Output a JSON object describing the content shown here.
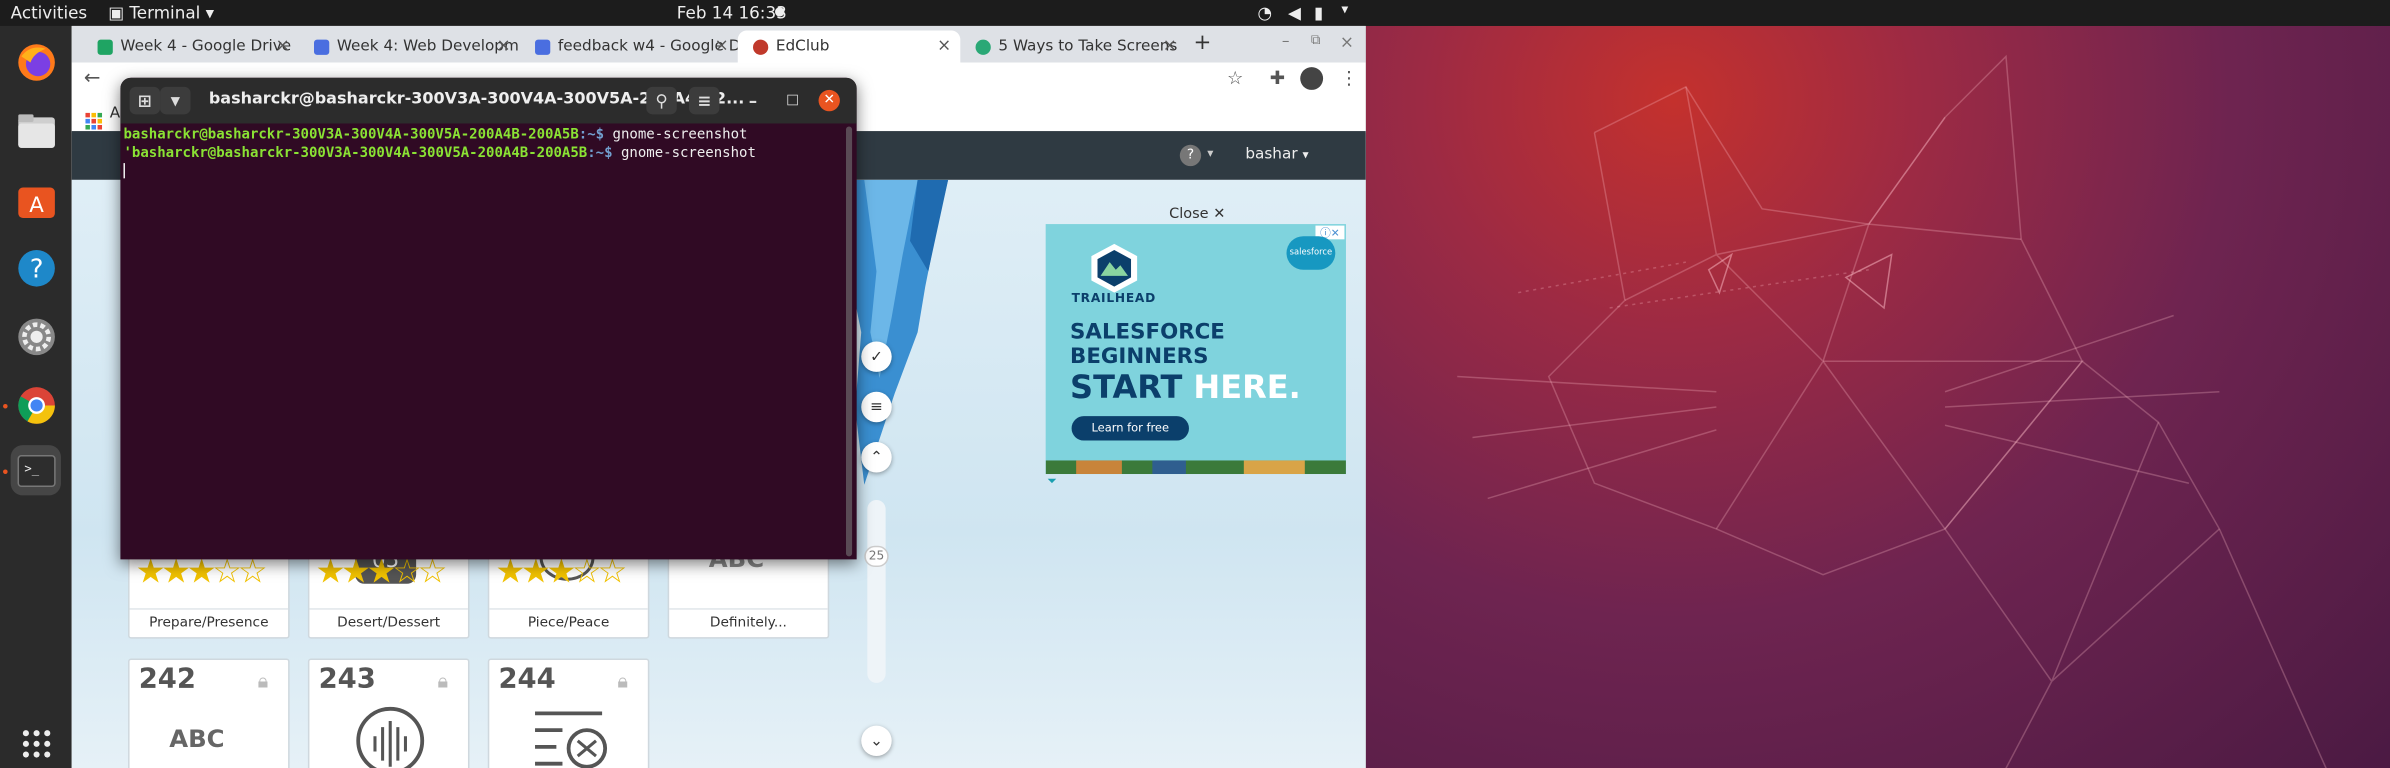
{
  "topbar": {
    "activities": "Activities",
    "app_menu": "Terminal",
    "datetime": "Feb 14  16:33"
  },
  "browser": {
    "tabs": [
      {
        "label": "Week 4 - Google Drive",
        "favicon_color": "#1fa463"
      },
      {
        "label": "Week 4: Web Developm",
        "favicon_color": "#4a6ee0"
      },
      {
        "label": "feedback w4 - Google D",
        "favicon_color": "#4a6ee0"
      },
      {
        "label": "EdClub",
        "favicon_color": "#c0392b"
      },
      {
        "label": "5 Ways to Take Screens",
        "favicon_color": "#2aa876"
      }
    ],
    "new_tab": "+",
    "bookmark_initial": "A"
  },
  "terminal": {
    "title": "basharckr@basharckr-300V3A-300V4A-300V5A-200A4B-200A5B: ~",
    "title_display": "basharckr@basharckr-300V3A-300V4A-300V5A-200A4B-2...",
    "prompt_user": "basharckr@basharckr-300V3A-300V4A-300V5A-200A4B-200A5B",
    "prompt_path": ":~$",
    "lines": [
      {
        "prefix": "",
        "command": " gnome-screenshot"
      },
      {
        "prefix": "'",
        "command": " gnome-screenshot"
      }
    ]
  },
  "site": {
    "user": "bashar",
    "help_icon": "?",
    "ad": {
      "close_label": "Close",
      "brand": "TRAILHEAD",
      "partner": "salesforce",
      "headline1": "SALESFORCE",
      "headline2": "BEGINNERS",
      "headline3a": "START",
      "headline3b": "HERE.",
      "cta": "Learn for free"
    },
    "scroll_value": "25",
    "lesson_cards": [
      {
        "label": "Prepare/Presence",
        "stars": 2.5
      },
      {
        "label": "Desert/Dessert",
        "stars": 2.5
      },
      {
        "label": "Piece/Peace",
        "stars": 2.5
      },
      {
        "label": "Definitely...",
        "stars": 0
      }
    ],
    "locked_cards": [
      {
        "number": "242",
        "glyph": "ABC"
      },
      {
        "number": "243",
        "glyph": ""
      },
      {
        "number": "244",
        "glyph": ""
      }
    ],
    "card_glyph_partial": "ABC"
  },
  "colors": {
    "desktop_purple": "#5e1f48",
    "terminal_bg": "#300a24",
    "prompt_green": "#8ae234",
    "prompt_blue": "#729fcf"
  }
}
